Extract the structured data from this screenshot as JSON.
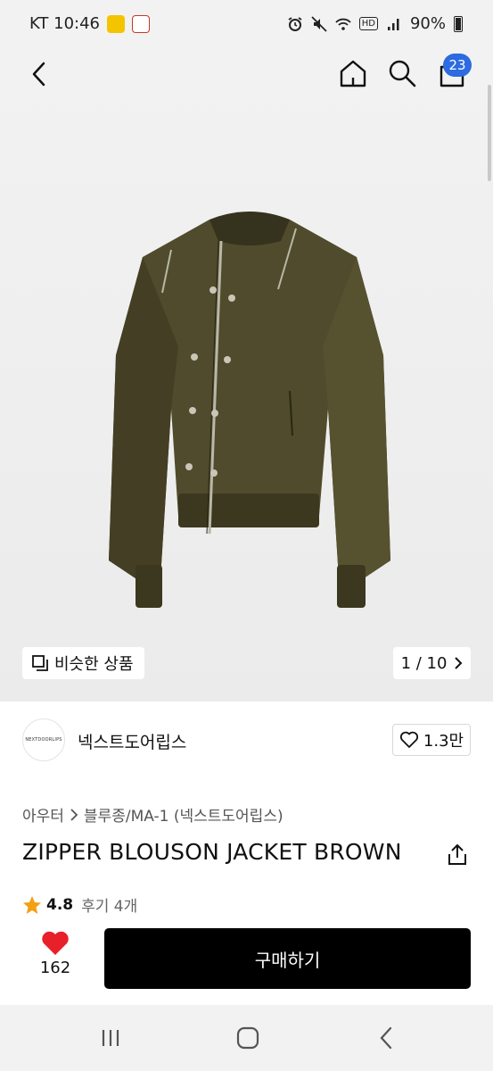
{
  "status_bar": {
    "carrier_time": "KT 10:46",
    "hd_label": "HD",
    "battery": "90%"
  },
  "nav": {
    "cart_count": "23"
  },
  "image": {
    "similar_label": "비슷한 상품",
    "pager": "1 / 10"
  },
  "brand": {
    "logo_text": "NEXTDOORLIPS",
    "name": "넥스트도어립스",
    "likes": "1.3만"
  },
  "product": {
    "breadcrumb_category": "아우터",
    "breadcrumb_sub": "블루종/MA-1 (넥스트도어립스)",
    "title": "ZIPPER BLOUSON JACKET BROWN",
    "rating": "4.8",
    "reviews": "후기 4개"
  },
  "bottom_bar": {
    "wish_count": "162",
    "buy_label": "구매하기"
  },
  "colors": {
    "accent_blue": "#2c6be0",
    "heart_red": "#e8202a",
    "star_orange": "#f3a014",
    "buy_button": "#000000"
  },
  "icons": [
    "back-icon",
    "home-icon",
    "search-icon",
    "cart-icon",
    "similar-icon",
    "chevron-right-icon",
    "heart-outline-icon",
    "share-icon",
    "star-icon",
    "heart-filled-icon",
    "recent-apps-icon",
    "home-circle-icon",
    "system-back-icon"
  ]
}
